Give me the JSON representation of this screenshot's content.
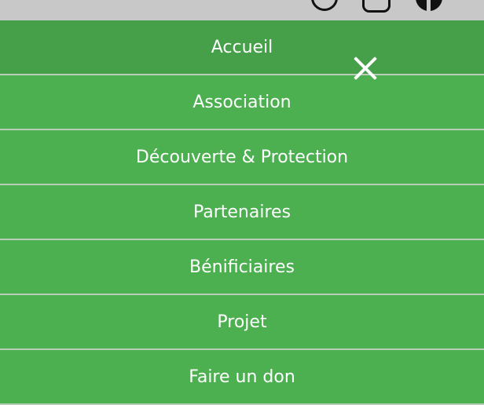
{
  "topbar": {
    "icons": [
      "circle-icon",
      "instagram-icon",
      "facebook-icon"
    ]
  },
  "menu": {
    "items": [
      {
        "label": "Accueil",
        "active": true
      },
      {
        "label": "Association"
      },
      {
        "label": "Découverte & Protection"
      },
      {
        "label": "Partenaires"
      },
      {
        "label": "Bénificiaires"
      },
      {
        "label": "Projet"
      },
      {
        "label": "Faire un don"
      }
    ]
  },
  "close_icon": "close-icon",
  "colors": {
    "menu_background": "#4caf50",
    "active_background": "#45a049",
    "topbar_background": "#c8c8c8",
    "text": "#ffffff"
  }
}
